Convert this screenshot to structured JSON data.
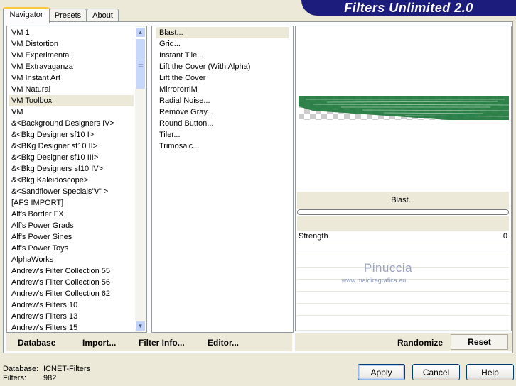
{
  "app": {
    "title": "Filters Unlimited 2.0"
  },
  "tabs": [
    {
      "label": "Navigator"
    },
    {
      "label": "Presets"
    },
    {
      "label": "About"
    }
  ],
  "categories": [
    "VM 1",
    "VM Distortion",
    "VM Experimental",
    "VM Extravaganza",
    "VM Instant Art",
    "VM Natural",
    "VM Toolbox",
    "VM",
    "&<Background Designers IV>",
    "&<Bkg Designer sf10 I>",
    "&<BKg Designer sf10 II>",
    "&<Bkg Designer sf10 III>",
    "&<Bkg Designers sf10 IV>",
    "&<Bkg Kaleidoscope>",
    "&<Sandflower Specials\"v\" >",
    "[AFS IMPORT]",
    "Alf's Border FX",
    "Alf's Power Grads",
    "Alf's Power Sines",
    "Alf's Power Toys",
    "AlphaWorks",
    "Andrew's Filter Collection 55",
    "Andrew's Filter Collection 56",
    "Andrew's Filter Collection 62",
    "Andrew's Filters 10",
    "Andrew's Filters 13",
    "Andrew's Filters 15"
  ],
  "selected_category": "VM Toolbox",
  "filters": [
    "Blast...",
    "Grid...",
    "Instant Tile...",
    "Lift the Cover (With Alpha)",
    "Lift the Cover",
    "MirrororriM",
    "Radial Noise...",
    "Remove Gray...",
    "Round Button...",
    "Tiler...",
    "Trimosaic..."
  ],
  "selected_filter": "Blast...",
  "preview": {
    "filter_name": "Blast...",
    "progress": 0,
    "accent": "#1e7a3c"
  },
  "params": [
    {
      "label": "Strength",
      "value": "0"
    }
  ],
  "watermark": {
    "name": "Pinuccia",
    "url": "www.maidiregrafica.eu"
  },
  "bottom_left": {
    "database": "Database",
    "import": "Import...",
    "filter_info": "Filter Info...",
    "editor": "Editor..."
  },
  "bottom_right": {
    "randomize": "Randomize",
    "reset": "Reset"
  },
  "status": {
    "db_label": "Database:",
    "db_value": "ICNET-Filters",
    "filters_label": "Filters:",
    "filters_value": "982"
  },
  "dialog": {
    "apply": "Apply",
    "cancel": "Cancel",
    "help": "Help"
  }
}
